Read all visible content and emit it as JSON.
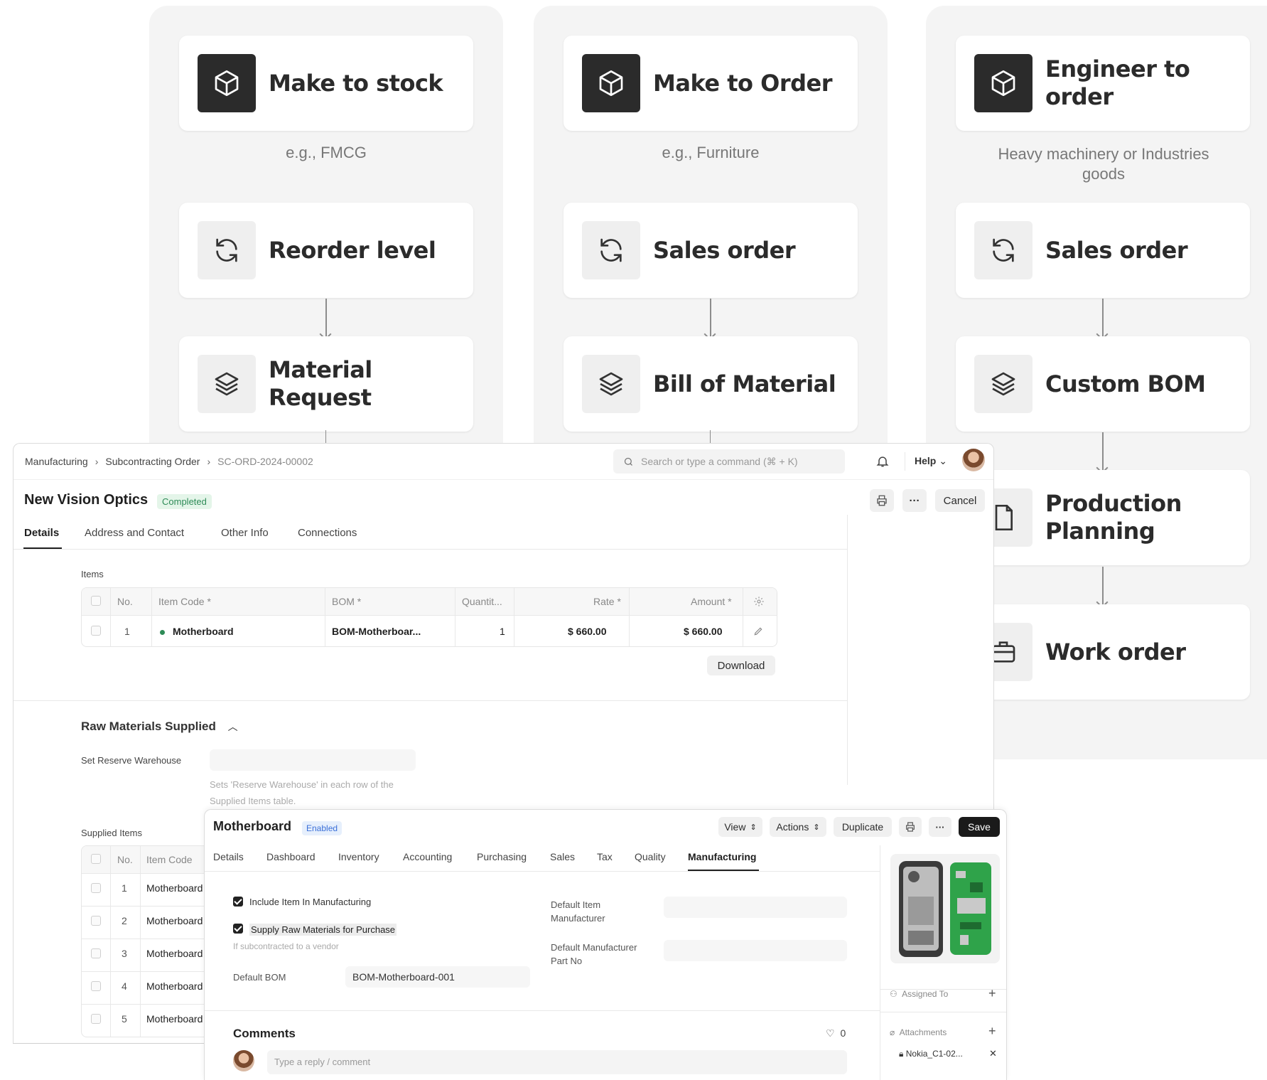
{
  "flow": {
    "columns": [
      {
        "top": "Make to stock",
        "example": "e.g., FMCG",
        "step1": "Reorder level",
        "step2": "Material Request"
      },
      {
        "top": "Make to Order",
        "example": "e.g., Furniture",
        "step1": "Sales order",
        "step2": "Bill of Material"
      },
      {
        "top": "Engineer to order",
        "example": "Heavy machinery or Industries goods",
        "step1": "Sales order",
        "step2": "Custom BOM",
        "step3": "Production Planning",
        "step4": "Work order"
      }
    ]
  },
  "order": {
    "breadcrumb": [
      "Manufacturing",
      "Subcontracting Order",
      "SC-ORD-2024-00002"
    ],
    "search_placeholder": "Search or type a command (⌘ + K)",
    "help": "Help",
    "title": "New Vision Optics",
    "status": "Completed",
    "more": "···",
    "cancel": "Cancel",
    "tabs": [
      "Details",
      "Address and Contact",
      "Other Info",
      "Connections"
    ],
    "items_label": "Items",
    "columns": [
      "No.",
      "Item Code *",
      "BOM *",
      "Quantit...",
      "Rate *",
      "Amount *"
    ],
    "row": {
      "no": "1",
      "item_code": "Motherboard",
      "bom": "BOM-Motherboar...",
      "qty": "1",
      "rate": "$ 660.00",
      "amount": "$ 660.00"
    },
    "download": "Download",
    "raw_title": "Raw Materials Supplied",
    "reserve_label": "Set Reserve Warehouse",
    "reserve_help": "Sets 'Reserve Warehouse' in each row of the Supplied Items table.",
    "supplied_label": "Supplied Items",
    "supplied_columns": [
      "No.",
      "Item Code"
    ],
    "supplied_rows": [
      {
        "no": "1",
        "code": "Motherboard"
      },
      {
        "no": "2",
        "code": "Motherboard"
      },
      {
        "no": "3",
        "code": "Motherboard"
      },
      {
        "no": "4",
        "code": "Motherboard"
      },
      {
        "no": "5",
        "code": "Motherboard"
      }
    ]
  },
  "item": {
    "title": "Motherboard",
    "status": "Enabled",
    "view": "View",
    "actions": "Actions",
    "duplicate": "Duplicate",
    "more": "···",
    "save": "Save",
    "tabs": [
      "Details",
      "Dashboard",
      "Inventory",
      "Accounting",
      "Purchasing",
      "Sales",
      "Tax",
      "Quality",
      "Manufacturing"
    ],
    "include_label": "Include Item In Manufacturing",
    "supply_label": "Supply Raw Materials for Purchase",
    "supply_help": "If subcontracted to a vendor",
    "default_bom_label": "Default BOM",
    "default_bom_value": "BOM-Motherboard-001",
    "manufacturer_label": "Default Item Manufacturer",
    "part_no_label": "Default Manufacturer Part No",
    "comments_title": "Comments",
    "likes": "0",
    "comment_placeholder": "Type a reply / comment",
    "assigned_to": "Assigned To",
    "attachments": "Attachments",
    "attachment_file": "Nokia_C1-02..."
  }
}
